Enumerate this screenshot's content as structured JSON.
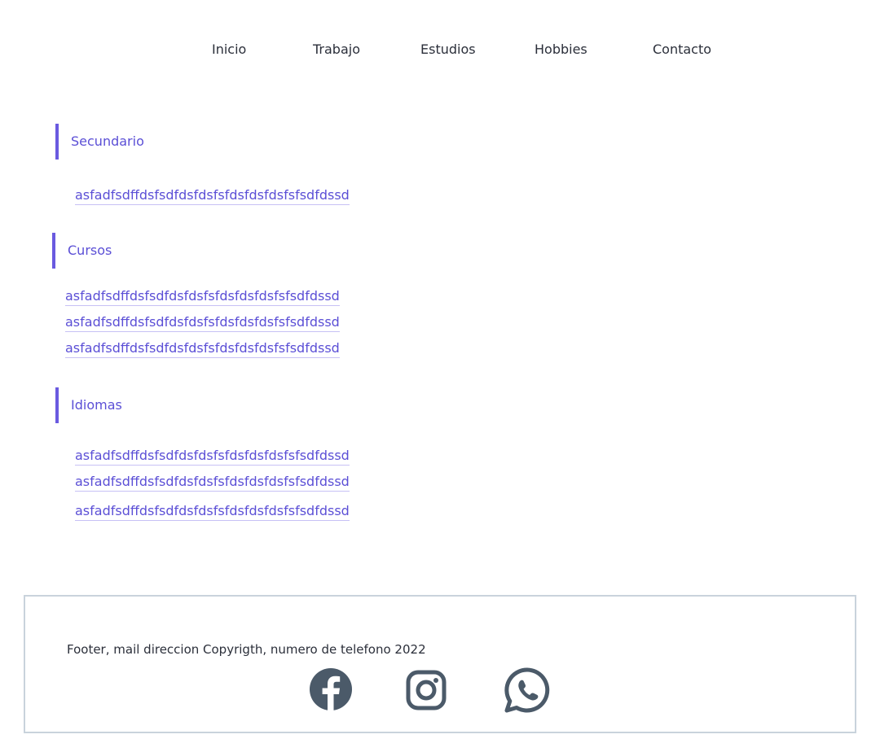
{
  "nav": {
    "items": [
      {
        "label": "Inicio"
      },
      {
        "label": "Trabajo"
      },
      {
        "label": "Estudios"
      },
      {
        "label": "Hobbies"
      },
      {
        "label": "Contacto"
      }
    ]
  },
  "sections": [
    {
      "title": "Secundario",
      "links": [
        "asfadfsdffdsfsdfdsfdsfsfdsfdsfdsfsfsdfdssd"
      ]
    },
    {
      "title": "Cursos",
      "links": [
        "asfadfsdffdsfsdfdsfdsfsfdsfdsfdsfsfsdfdssd",
        "asfadfsdffdsfsdfdsfdsfsfdsfdsfdsfsfsdfdssd",
        "asfadfsdffdsfsdfdsfdsfsfdsfdsfdsfsfsdfdssd"
      ]
    },
    {
      "title": "Idiomas",
      "links": [
        "asfadfsdffdsfsdfdsfdsfsfdsfdsfdsfsfsdfdssd",
        "asfadfsdffdsfsdfdsfdsfsfdsfdsfdsfsfsdfdssd",
        "asfadfsdffdsfsdfdsfdsfsfdsfdsfdsfsfsdfdssd"
      ]
    }
  ],
  "footer": {
    "text": "Footer, mail direccion Copyrigth, numero de telefono 2022",
    "icons": [
      "facebook-icon",
      "instagram-icon",
      "whatsapp-icon"
    ]
  },
  "colors": {
    "accent": "#6a5ae0",
    "link": "#5b4fd6",
    "text": "#2b2f3a",
    "icon": "#4b5a69",
    "footer_border": "#c9d3dc"
  }
}
